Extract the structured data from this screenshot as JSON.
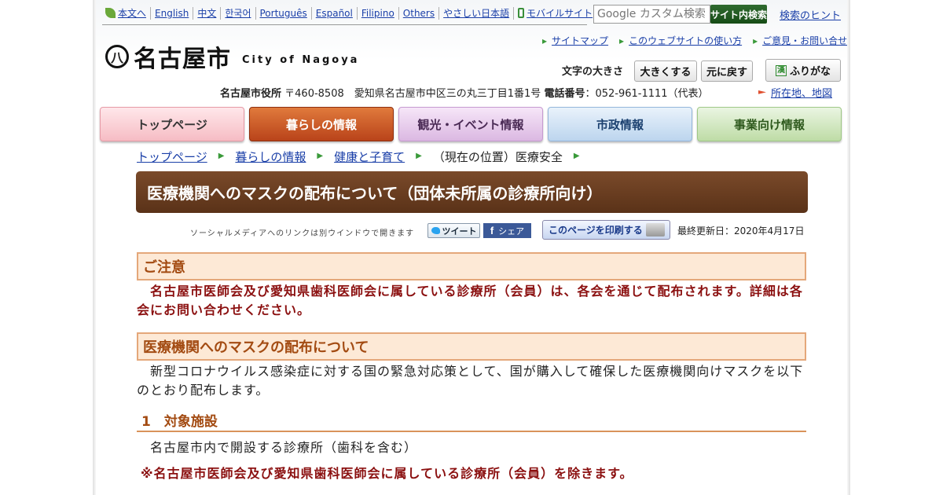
{
  "lang_bar": {
    "items": [
      "本文へ",
      "English",
      "中文",
      "한국어",
      "Português",
      "Español",
      "Filipino",
      "Others",
      "やさしい日本語",
      "モバイルサイト"
    ]
  },
  "search": {
    "placeholder": "Google カスタム検索",
    "button_label": "サイト内検索",
    "hint_link": "検索のヒント"
  },
  "logo": {
    "mark": "八",
    "name": "名古屋市",
    "english": "City of Nagoya"
  },
  "util_links": [
    "サイトマップ",
    "このウェブサイトの使い方",
    "ご意見・お問い合せ"
  ],
  "font_size": {
    "label": "文字の大きさ",
    "larger": "大きくする",
    "reset": "元に戻す",
    "furigana": "ふりがな",
    "furigana_mark": "漢"
  },
  "address": {
    "office": "名古屋市役所",
    "postal_and_address": "〒460-8508　愛知県名古屋市中区三の丸三丁目1番1号",
    "phone_label": "電話番号",
    "phone_value": "：052-961-1111（代表）",
    "map_link": "所在地、地図"
  },
  "nav": {
    "top": "トップページ",
    "life": "暮らしの情報",
    "tour": "観光・イベント情報",
    "city": "市政情報",
    "biz": "事業向け情報"
  },
  "breadcrumb": {
    "items": [
      "トップページ",
      "暮らしの情報",
      "健康と子育て"
    ],
    "current": "（現在の位置）医療安全"
  },
  "title": "医療機関へのマスクの配布について（団体未所属の診療所向け）",
  "social": {
    "note": "ソーシャルメディアへのリンクは別ウインドウで開きます",
    "tweet": "ツイート",
    "share": "シェア",
    "share_mark": "f",
    "print": "このページを印刷する",
    "updated": "最終更新日：2020年4月17日"
  },
  "content": {
    "caution_head": "ご注意",
    "caution_text": "　名古屋市医師会及び愛知県歯科医師会に属している診療所（会員）は、各会を通じて配布されます。詳細は各会にお問い合わせください。",
    "mask_head": "医療機関へのマスクの配布について",
    "mask_text": "　新型コロナウイルス感染症に対する国の緊急対応策として、国が購入して確保した医療機関向けマスクを以下のとおり配布します。",
    "sub_head": "1　対象施設",
    "facility": "名古屋市内で開設する診療所（歯科を含む）",
    "exclusion": "※名古屋市医師会及び愛知県歯科医師会に属している診療所（会員）を除きます。"
  }
}
